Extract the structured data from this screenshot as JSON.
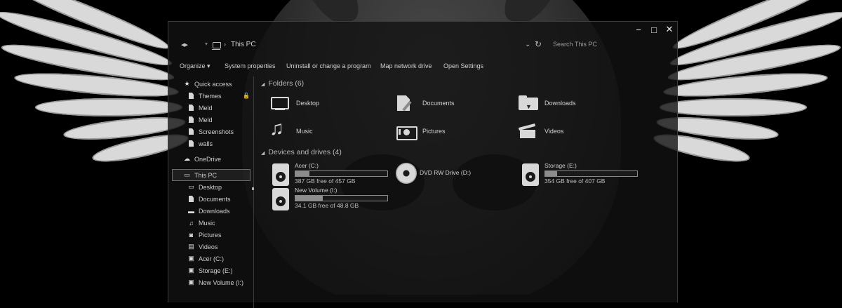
{
  "window": {
    "breadcrumb": "This PC",
    "search_placeholder": "Search This PC",
    "caption": {
      "minimize": "−",
      "maximize": "□",
      "close": "✕"
    },
    "nav_arrows": "◂▸",
    "addr_down": "▾",
    "crumb_sep": "›",
    "addr_chevron": "⌄",
    "refresh": "↻"
  },
  "ribbon": {
    "organize": "Organize ▾",
    "system_properties": "System properties",
    "uninstall": "Uninstall or change a program",
    "map_drive": "Map network drive",
    "open_settings": "Open Settings"
  },
  "nav": {
    "quick_access": "Quick access",
    "quick_items": [
      "Themes",
      "Meld",
      "Meld",
      "Screenshots",
      "walls"
    ],
    "onedrive": "OneDrive",
    "this_pc": "This PC",
    "pc_items": [
      "Desktop",
      "Documents",
      "Downloads",
      "Music",
      "Pictures",
      "Videos",
      "Acer (C:)",
      "Storage (E:)",
      "New Volume (I:)"
    ]
  },
  "folders": {
    "header": "Folders (6)",
    "items": [
      "Desktop",
      "Documents",
      "Downloads",
      "Music",
      "Pictures",
      "Videos"
    ]
  },
  "drives": {
    "header": "Devices and drives (4)",
    "acer": {
      "name": "Acer (C:)",
      "free": "387 GB free of 457 GB",
      "used_fraction": 0.153
    },
    "dvd": {
      "name": "DVD RW Drive (D:)"
    },
    "storage": {
      "name": "Storage (E:)",
      "free": "354 GB free of 407 GB",
      "used_fraction": 0.13
    },
    "newvol": {
      "name": "New Volume (I:)",
      "free": "34.1 GB free of 48.8 GB",
      "used_fraction": 0.301
    }
  },
  "colors": {
    "accent": "#d8d8d8",
    "window_bg": "#121212"
  }
}
